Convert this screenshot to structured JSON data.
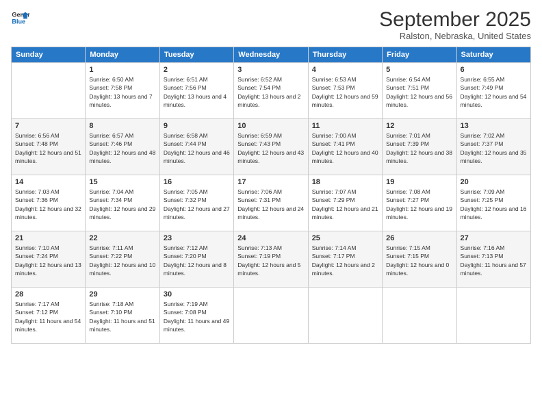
{
  "header": {
    "logo_line1": "General",
    "logo_line2": "Blue",
    "month": "September 2025",
    "location": "Ralston, Nebraska, United States"
  },
  "weekdays": [
    "Sunday",
    "Monday",
    "Tuesday",
    "Wednesday",
    "Thursday",
    "Friday",
    "Saturday"
  ],
  "weeks": [
    [
      {
        "day": "",
        "sunrise": "",
        "sunset": "",
        "daylight": ""
      },
      {
        "day": "1",
        "sunrise": "Sunrise: 6:50 AM",
        "sunset": "Sunset: 7:58 PM",
        "daylight": "Daylight: 13 hours and 7 minutes."
      },
      {
        "day": "2",
        "sunrise": "Sunrise: 6:51 AM",
        "sunset": "Sunset: 7:56 PM",
        "daylight": "Daylight: 13 hours and 4 minutes."
      },
      {
        "day": "3",
        "sunrise": "Sunrise: 6:52 AM",
        "sunset": "Sunset: 7:54 PM",
        "daylight": "Daylight: 13 hours and 2 minutes."
      },
      {
        "day": "4",
        "sunrise": "Sunrise: 6:53 AM",
        "sunset": "Sunset: 7:53 PM",
        "daylight": "Daylight: 12 hours and 59 minutes."
      },
      {
        "day": "5",
        "sunrise": "Sunrise: 6:54 AM",
        "sunset": "Sunset: 7:51 PM",
        "daylight": "Daylight: 12 hours and 56 minutes."
      },
      {
        "day": "6",
        "sunrise": "Sunrise: 6:55 AM",
        "sunset": "Sunset: 7:49 PM",
        "daylight": "Daylight: 12 hours and 54 minutes."
      }
    ],
    [
      {
        "day": "7",
        "sunrise": "Sunrise: 6:56 AM",
        "sunset": "Sunset: 7:48 PM",
        "daylight": "Daylight: 12 hours and 51 minutes."
      },
      {
        "day": "8",
        "sunrise": "Sunrise: 6:57 AM",
        "sunset": "Sunset: 7:46 PM",
        "daylight": "Daylight: 12 hours and 48 minutes."
      },
      {
        "day": "9",
        "sunrise": "Sunrise: 6:58 AM",
        "sunset": "Sunset: 7:44 PM",
        "daylight": "Daylight: 12 hours and 46 minutes."
      },
      {
        "day": "10",
        "sunrise": "Sunrise: 6:59 AM",
        "sunset": "Sunset: 7:43 PM",
        "daylight": "Daylight: 12 hours and 43 minutes."
      },
      {
        "day": "11",
        "sunrise": "Sunrise: 7:00 AM",
        "sunset": "Sunset: 7:41 PM",
        "daylight": "Daylight: 12 hours and 40 minutes."
      },
      {
        "day": "12",
        "sunrise": "Sunrise: 7:01 AM",
        "sunset": "Sunset: 7:39 PM",
        "daylight": "Daylight: 12 hours and 38 minutes."
      },
      {
        "day": "13",
        "sunrise": "Sunrise: 7:02 AM",
        "sunset": "Sunset: 7:37 PM",
        "daylight": "Daylight: 12 hours and 35 minutes."
      }
    ],
    [
      {
        "day": "14",
        "sunrise": "Sunrise: 7:03 AM",
        "sunset": "Sunset: 7:36 PM",
        "daylight": "Daylight: 12 hours and 32 minutes."
      },
      {
        "day": "15",
        "sunrise": "Sunrise: 7:04 AM",
        "sunset": "Sunset: 7:34 PM",
        "daylight": "Daylight: 12 hours and 29 minutes."
      },
      {
        "day": "16",
        "sunrise": "Sunrise: 7:05 AM",
        "sunset": "Sunset: 7:32 PM",
        "daylight": "Daylight: 12 hours and 27 minutes."
      },
      {
        "day": "17",
        "sunrise": "Sunrise: 7:06 AM",
        "sunset": "Sunset: 7:31 PM",
        "daylight": "Daylight: 12 hours and 24 minutes."
      },
      {
        "day": "18",
        "sunrise": "Sunrise: 7:07 AM",
        "sunset": "Sunset: 7:29 PM",
        "daylight": "Daylight: 12 hours and 21 minutes."
      },
      {
        "day": "19",
        "sunrise": "Sunrise: 7:08 AM",
        "sunset": "Sunset: 7:27 PM",
        "daylight": "Daylight: 12 hours and 19 minutes."
      },
      {
        "day": "20",
        "sunrise": "Sunrise: 7:09 AM",
        "sunset": "Sunset: 7:25 PM",
        "daylight": "Daylight: 12 hours and 16 minutes."
      }
    ],
    [
      {
        "day": "21",
        "sunrise": "Sunrise: 7:10 AM",
        "sunset": "Sunset: 7:24 PM",
        "daylight": "Daylight: 12 hours and 13 minutes."
      },
      {
        "day": "22",
        "sunrise": "Sunrise: 7:11 AM",
        "sunset": "Sunset: 7:22 PM",
        "daylight": "Daylight: 12 hours and 10 minutes."
      },
      {
        "day": "23",
        "sunrise": "Sunrise: 7:12 AM",
        "sunset": "Sunset: 7:20 PM",
        "daylight": "Daylight: 12 hours and 8 minutes."
      },
      {
        "day": "24",
        "sunrise": "Sunrise: 7:13 AM",
        "sunset": "Sunset: 7:19 PM",
        "daylight": "Daylight: 12 hours and 5 minutes."
      },
      {
        "day": "25",
        "sunrise": "Sunrise: 7:14 AM",
        "sunset": "Sunset: 7:17 PM",
        "daylight": "Daylight: 12 hours and 2 minutes."
      },
      {
        "day": "26",
        "sunrise": "Sunrise: 7:15 AM",
        "sunset": "Sunset: 7:15 PM",
        "daylight": "Daylight: 12 hours and 0 minutes."
      },
      {
        "day": "27",
        "sunrise": "Sunrise: 7:16 AM",
        "sunset": "Sunset: 7:13 PM",
        "daylight": "Daylight: 11 hours and 57 minutes."
      }
    ],
    [
      {
        "day": "28",
        "sunrise": "Sunrise: 7:17 AM",
        "sunset": "Sunset: 7:12 PM",
        "daylight": "Daylight: 11 hours and 54 minutes."
      },
      {
        "day": "29",
        "sunrise": "Sunrise: 7:18 AM",
        "sunset": "Sunset: 7:10 PM",
        "daylight": "Daylight: 11 hours and 51 minutes."
      },
      {
        "day": "30",
        "sunrise": "Sunrise: 7:19 AM",
        "sunset": "Sunset: 7:08 PM",
        "daylight": "Daylight: 11 hours and 49 minutes."
      },
      {
        "day": "",
        "sunrise": "",
        "sunset": "",
        "daylight": ""
      },
      {
        "day": "",
        "sunrise": "",
        "sunset": "",
        "daylight": ""
      },
      {
        "day": "",
        "sunrise": "",
        "sunset": "",
        "daylight": ""
      },
      {
        "day": "",
        "sunrise": "",
        "sunset": "",
        "daylight": ""
      }
    ]
  ]
}
